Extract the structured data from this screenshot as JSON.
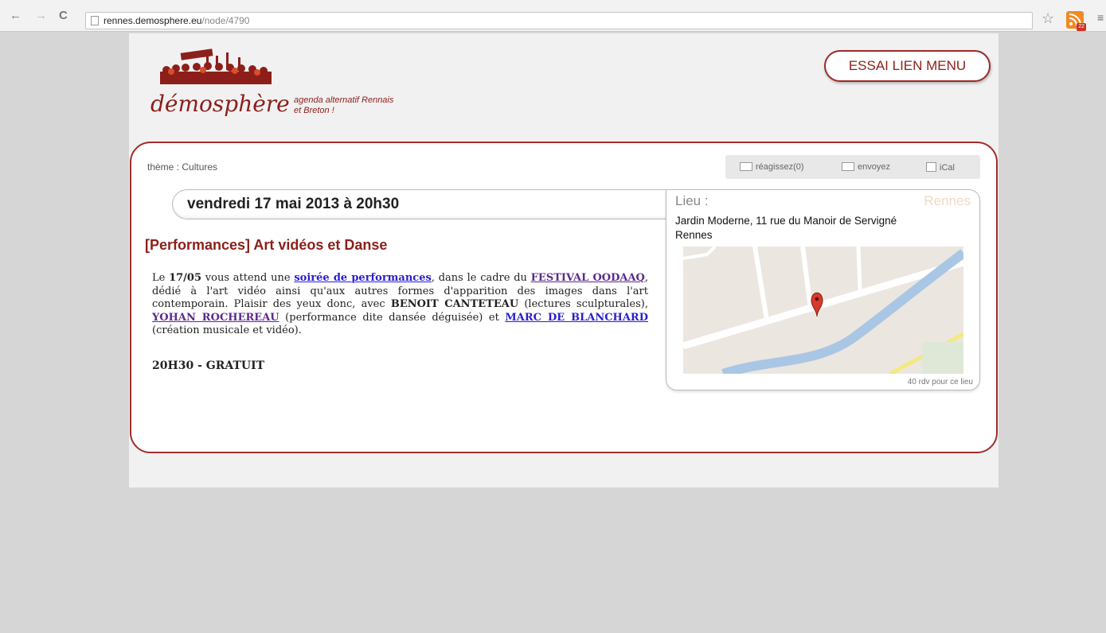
{
  "browser": {
    "back_glyph": "←",
    "forward_glyph": "→",
    "reload_glyph": "C",
    "url_host": "rennes.demosphere.eu",
    "url_path": "/node/4790",
    "star_glyph": "☆",
    "rss_badge": "22",
    "menu_glyph": "≡"
  },
  "header": {
    "logo_text": "démosphère",
    "tagline_1": "agenda alternatif Rennais",
    "tagline_2": "et Breton !",
    "menu_button": "ESSAI LIEN MENU"
  },
  "event": {
    "theme": "thème : Cultures",
    "actions": [
      "réagissez(0)",
      "envoyez",
      "iCal"
    ],
    "date": "vendredi 17 mai 2013 à 20h30",
    "title": "[Performances] Art vidéos et Danse",
    "body": {
      "t1": "Le ",
      "date_bold": "17/05",
      "t2": " vous attend une ",
      "link1": "soirée de performances",
      "t3": ", dans le cadre du ",
      "link2": "FESTIVAL OODAAQ",
      "t4": ", dédié à l'art vidéo ainsi qu'aux autres formes d'apparition des images dans l'art contemporain. Plaisir des yeux donc, avec ",
      "bold1": "BENOIT CANTETEAU",
      "t5": " (lectures sculpturales), ",
      "link3": "YOHAN ROCHEREAU",
      "t6": " (performance dite dansée déguisée) et ",
      "link4": "MARC DE BLANCHARD",
      "t7": " (création musicale et vidéo)."
    },
    "price": "20H30 - GRATUIT"
  },
  "place": {
    "label": "Lieu :",
    "city": "Rennes",
    "address_1": "Jardin Moderne, 11 rue du Manoir de Servigné",
    "address_2": "Rennes",
    "rdv_count": "40 rdv pour ce lieu"
  },
  "colors": {
    "brand": "#8c1f1a",
    "panel_border": "#a32c2c",
    "link": "#2a1ecf",
    "link_visited": "#5b2a8c",
    "map_water": "#a9c7e4",
    "map_road_yellow": "#f4e880"
  }
}
